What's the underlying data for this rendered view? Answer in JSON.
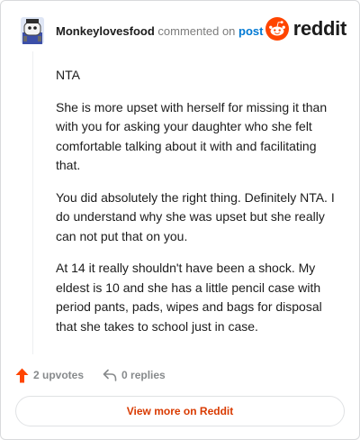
{
  "header": {
    "username": "Monkeylovesfood",
    "action_text": "commented on",
    "post_link": "post",
    "brand_name": "reddit",
    "avatar_icon": "snoo-avatar-icon",
    "logo_icon": "reddit-snoo-logo-icon"
  },
  "comment": {
    "paragraphs": [
      "NTA",
      "She is more upset with herself for missing it than with you for asking your daughter who she felt comfortable talking about it with and facilitating that.",
      "You did absolutely the right thing. Definitely NTA. I do understand why she was upset but she really can not put that on you.",
      "At 14 it really shouldn't have been a shock. My eldest is 10 and she has a little pencil case with period pants, pads, wipes and bags for disposal that she takes to school just in case."
    ]
  },
  "actions": {
    "upvotes": "2 upvotes",
    "replies": "0 replies",
    "upvote_icon": "upvote-arrow-icon",
    "reply_icon": "reply-arrow-icon"
  },
  "cta": {
    "label": "View more on Reddit"
  },
  "colors": {
    "brand_orange": "#ff4500",
    "link_blue": "#0079d3",
    "cta_text": "#d93a00",
    "muted": "#878a8c"
  }
}
